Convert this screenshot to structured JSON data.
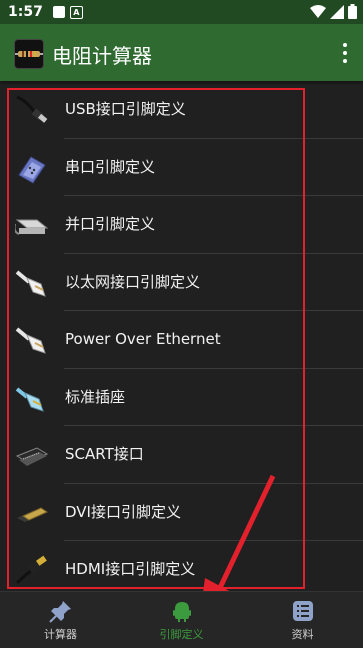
{
  "status_bar": {
    "time": "1:57",
    "notification_letter": "A"
  },
  "app_bar": {
    "title": "电阻计算器",
    "icon": "resistor-app-icon",
    "menu_icon": "more-vert-icon"
  },
  "list": {
    "items": [
      {
        "label": "USB接口引脚定义",
        "icon": "usb-cable-icon"
      },
      {
        "label": "串口引脚定义",
        "icon": "serial-port-icon"
      },
      {
        "label": "并口引脚定义",
        "icon": "parallel-port-icon"
      },
      {
        "label": "以太网接口引脚定义",
        "icon": "ethernet-plug-icon"
      },
      {
        "label": "Power Over Ethernet",
        "icon": "poe-plug-icon"
      },
      {
        "label": "标准插座",
        "icon": "phone-plug-icon"
      },
      {
        "label": "SCART接口",
        "icon": "scart-connector-icon"
      },
      {
        "label": "DVI接口引脚定义",
        "icon": "dvi-connector-icon"
      },
      {
        "label": "HDMI接口引脚定义",
        "icon": "hdmi-cable-icon"
      }
    ]
  },
  "bottom_nav": {
    "tabs": [
      {
        "label": "计算器",
        "icon": "pin-icon",
        "active": false
      },
      {
        "label": "引脚定义",
        "icon": "android-chip-icon",
        "active": true
      },
      {
        "label": "资料",
        "icon": "list-icon",
        "active": false
      }
    ]
  },
  "colors": {
    "app_bar": "#2f6b31",
    "status_bar": "#214a23",
    "background": "#202020",
    "accent_active": "#3c9b3e",
    "annotation_red": "#e3212c"
  }
}
